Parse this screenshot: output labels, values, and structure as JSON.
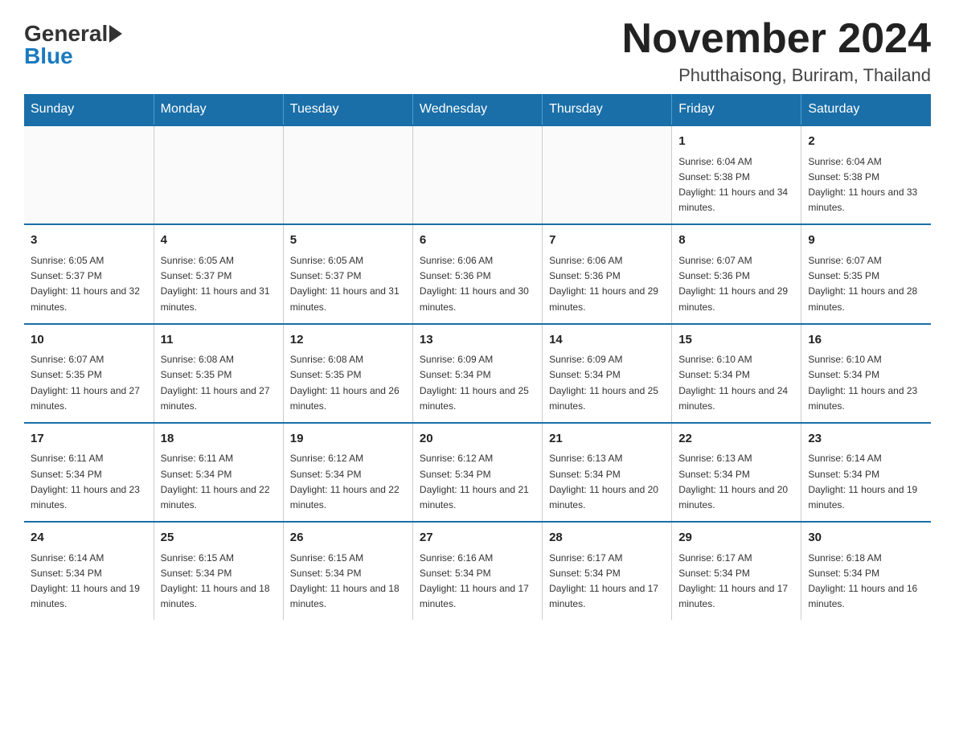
{
  "logo": {
    "general": "General",
    "blue": "Blue"
  },
  "title": "November 2024",
  "location": "Phutthaisong, Buriram, Thailand",
  "weekdays": [
    "Sunday",
    "Monday",
    "Tuesday",
    "Wednesday",
    "Thursday",
    "Friday",
    "Saturday"
  ],
  "weeks": [
    [
      {
        "day": "",
        "sunrise": "",
        "sunset": "",
        "daylight": ""
      },
      {
        "day": "",
        "sunrise": "",
        "sunset": "",
        "daylight": ""
      },
      {
        "day": "",
        "sunrise": "",
        "sunset": "",
        "daylight": ""
      },
      {
        "day": "",
        "sunrise": "",
        "sunset": "",
        "daylight": ""
      },
      {
        "day": "",
        "sunrise": "",
        "sunset": "",
        "daylight": ""
      },
      {
        "day": "1",
        "sunrise": "Sunrise: 6:04 AM",
        "sunset": "Sunset: 5:38 PM",
        "daylight": "Daylight: 11 hours and 34 minutes."
      },
      {
        "day": "2",
        "sunrise": "Sunrise: 6:04 AM",
        "sunset": "Sunset: 5:38 PM",
        "daylight": "Daylight: 11 hours and 33 minutes."
      }
    ],
    [
      {
        "day": "3",
        "sunrise": "Sunrise: 6:05 AM",
        "sunset": "Sunset: 5:37 PM",
        "daylight": "Daylight: 11 hours and 32 minutes."
      },
      {
        "day": "4",
        "sunrise": "Sunrise: 6:05 AM",
        "sunset": "Sunset: 5:37 PM",
        "daylight": "Daylight: 11 hours and 31 minutes."
      },
      {
        "day": "5",
        "sunrise": "Sunrise: 6:05 AM",
        "sunset": "Sunset: 5:37 PM",
        "daylight": "Daylight: 11 hours and 31 minutes."
      },
      {
        "day": "6",
        "sunrise": "Sunrise: 6:06 AM",
        "sunset": "Sunset: 5:36 PM",
        "daylight": "Daylight: 11 hours and 30 minutes."
      },
      {
        "day": "7",
        "sunrise": "Sunrise: 6:06 AM",
        "sunset": "Sunset: 5:36 PM",
        "daylight": "Daylight: 11 hours and 29 minutes."
      },
      {
        "day": "8",
        "sunrise": "Sunrise: 6:07 AM",
        "sunset": "Sunset: 5:36 PM",
        "daylight": "Daylight: 11 hours and 29 minutes."
      },
      {
        "day": "9",
        "sunrise": "Sunrise: 6:07 AM",
        "sunset": "Sunset: 5:35 PM",
        "daylight": "Daylight: 11 hours and 28 minutes."
      }
    ],
    [
      {
        "day": "10",
        "sunrise": "Sunrise: 6:07 AM",
        "sunset": "Sunset: 5:35 PM",
        "daylight": "Daylight: 11 hours and 27 minutes."
      },
      {
        "day": "11",
        "sunrise": "Sunrise: 6:08 AM",
        "sunset": "Sunset: 5:35 PM",
        "daylight": "Daylight: 11 hours and 27 minutes."
      },
      {
        "day": "12",
        "sunrise": "Sunrise: 6:08 AM",
        "sunset": "Sunset: 5:35 PM",
        "daylight": "Daylight: 11 hours and 26 minutes."
      },
      {
        "day": "13",
        "sunrise": "Sunrise: 6:09 AM",
        "sunset": "Sunset: 5:34 PM",
        "daylight": "Daylight: 11 hours and 25 minutes."
      },
      {
        "day": "14",
        "sunrise": "Sunrise: 6:09 AM",
        "sunset": "Sunset: 5:34 PM",
        "daylight": "Daylight: 11 hours and 25 minutes."
      },
      {
        "day": "15",
        "sunrise": "Sunrise: 6:10 AM",
        "sunset": "Sunset: 5:34 PM",
        "daylight": "Daylight: 11 hours and 24 minutes."
      },
      {
        "day": "16",
        "sunrise": "Sunrise: 6:10 AM",
        "sunset": "Sunset: 5:34 PM",
        "daylight": "Daylight: 11 hours and 23 minutes."
      }
    ],
    [
      {
        "day": "17",
        "sunrise": "Sunrise: 6:11 AM",
        "sunset": "Sunset: 5:34 PM",
        "daylight": "Daylight: 11 hours and 23 minutes."
      },
      {
        "day": "18",
        "sunrise": "Sunrise: 6:11 AM",
        "sunset": "Sunset: 5:34 PM",
        "daylight": "Daylight: 11 hours and 22 minutes."
      },
      {
        "day": "19",
        "sunrise": "Sunrise: 6:12 AM",
        "sunset": "Sunset: 5:34 PM",
        "daylight": "Daylight: 11 hours and 22 minutes."
      },
      {
        "day": "20",
        "sunrise": "Sunrise: 6:12 AM",
        "sunset": "Sunset: 5:34 PM",
        "daylight": "Daylight: 11 hours and 21 minutes."
      },
      {
        "day": "21",
        "sunrise": "Sunrise: 6:13 AM",
        "sunset": "Sunset: 5:34 PM",
        "daylight": "Daylight: 11 hours and 20 minutes."
      },
      {
        "day": "22",
        "sunrise": "Sunrise: 6:13 AM",
        "sunset": "Sunset: 5:34 PM",
        "daylight": "Daylight: 11 hours and 20 minutes."
      },
      {
        "day": "23",
        "sunrise": "Sunrise: 6:14 AM",
        "sunset": "Sunset: 5:34 PM",
        "daylight": "Daylight: 11 hours and 19 minutes."
      }
    ],
    [
      {
        "day": "24",
        "sunrise": "Sunrise: 6:14 AM",
        "sunset": "Sunset: 5:34 PM",
        "daylight": "Daylight: 11 hours and 19 minutes."
      },
      {
        "day": "25",
        "sunrise": "Sunrise: 6:15 AM",
        "sunset": "Sunset: 5:34 PM",
        "daylight": "Daylight: 11 hours and 18 minutes."
      },
      {
        "day": "26",
        "sunrise": "Sunrise: 6:15 AM",
        "sunset": "Sunset: 5:34 PM",
        "daylight": "Daylight: 11 hours and 18 minutes."
      },
      {
        "day": "27",
        "sunrise": "Sunrise: 6:16 AM",
        "sunset": "Sunset: 5:34 PM",
        "daylight": "Daylight: 11 hours and 17 minutes."
      },
      {
        "day": "28",
        "sunrise": "Sunrise: 6:17 AM",
        "sunset": "Sunset: 5:34 PM",
        "daylight": "Daylight: 11 hours and 17 minutes."
      },
      {
        "day": "29",
        "sunrise": "Sunrise: 6:17 AM",
        "sunset": "Sunset: 5:34 PM",
        "daylight": "Daylight: 11 hours and 17 minutes."
      },
      {
        "day": "30",
        "sunrise": "Sunrise: 6:18 AM",
        "sunset": "Sunset: 5:34 PM",
        "daylight": "Daylight: 11 hours and 16 minutes."
      }
    ]
  ]
}
